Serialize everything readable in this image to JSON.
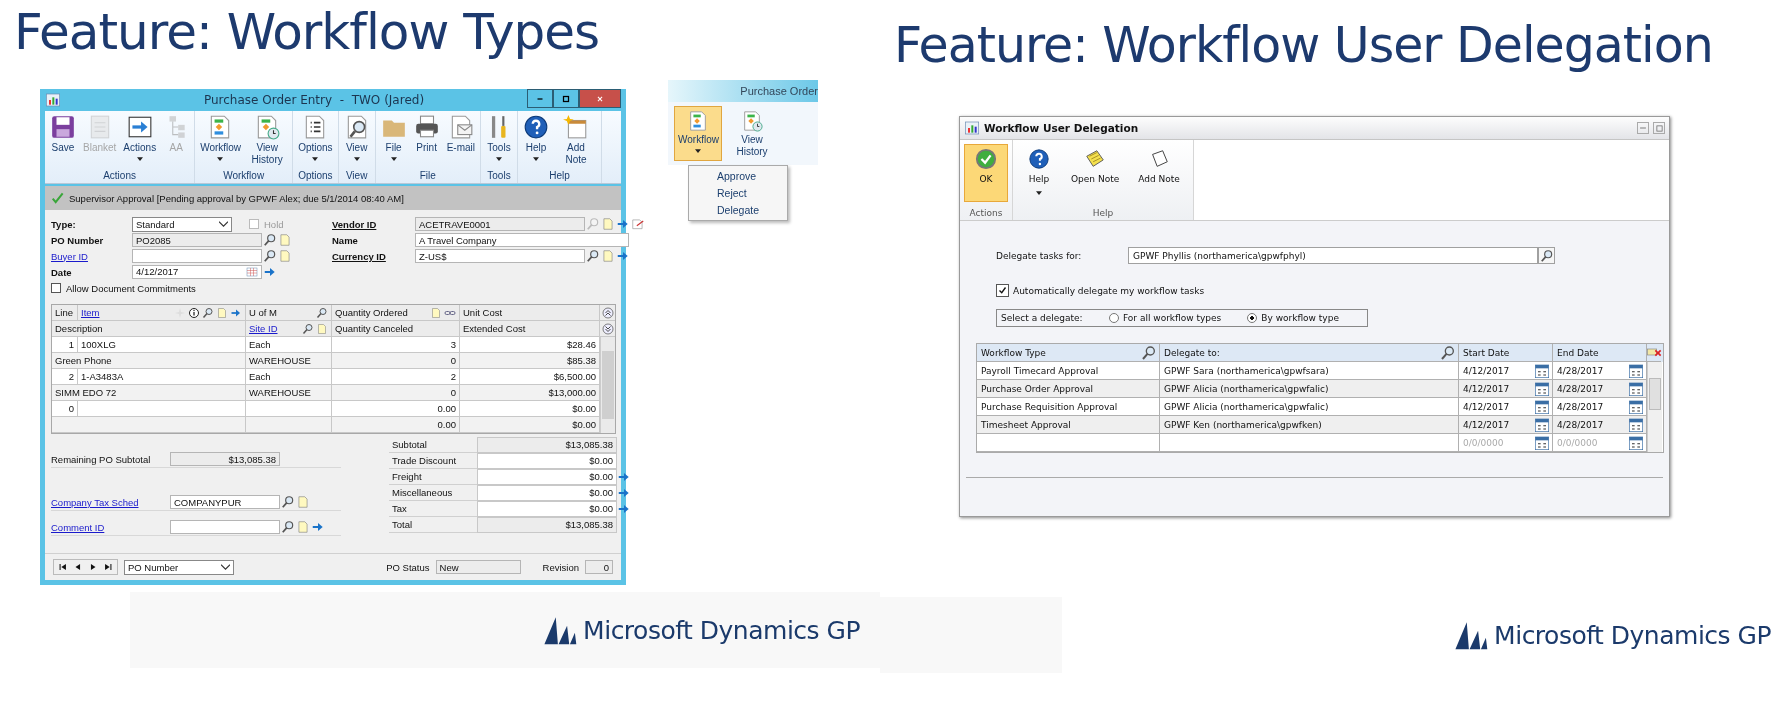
{
  "left_slide": {
    "title": "Feature: Workflow Types",
    "window": {
      "title": "Purchase Order Entry  -  TWO (Jared)",
      "ribbon": [
        {
          "label": "Actions",
          "buttons": [
            {
              "label": "Save",
              "disabled": false,
              "dropdown": false
            },
            {
              "label": "Blanket",
              "disabled": true,
              "dropdown": false
            },
            {
              "label": "Actions",
              "disabled": false,
              "dropdown": true
            },
            {
              "label": "AA",
              "disabled": true,
              "dropdown": false
            }
          ]
        },
        {
          "label": "Workflow",
          "buttons": [
            {
              "label": "Workflow",
              "disabled": false,
              "dropdown": true
            },
            {
              "label": "View History",
              "disabled": false,
              "dropdown": false
            }
          ]
        },
        {
          "label": "Options",
          "buttons": [
            {
              "label": "Options",
              "disabled": false,
              "dropdown": true
            }
          ]
        },
        {
          "label": "View",
          "buttons": [
            {
              "label": "View",
              "disabled": false,
              "dropdown": true
            }
          ]
        },
        {
          "label": "File",
          "buttons": [
            {
              "label": "File",
              "disabled": false,
              "dropdown": true
            },
            {
              "label": "Print",
              "disabled": false,
              "dropdown": false
            },
            {
              "label": "E-mail",
              "disabled": false,
              "dropdown": false
            }
          ]
        },
        {
          "label": "Tools",
          "buttons": [
            {
              "label": "Tools",
              "disabled": false,
              "dropdown": true
            }
          ]
        },
        {
          "label": "Help",
          "buttons": [
            {
              "label": "Help",
              "disabled": false,
              "dropdown": true
            },
            {
              "label": "Add Note",
              "disabled": false,
              "dropdown": false
            }
          ]
        }
      ],
      "approval": "Supervisor Approval [Pending approval by GPWF Alex; due 5/1/2014 08:40 AM]",
      "type": {
        "label": "Type:",
        "value": "Standard"
      },
      "hold": {
        "label": "Hold",
        "checked": false,
        "disabled": true
      },
      "po_number": {
        "label": "PO Number",
        "value": "PO2085"
      },
      "buyer_id": {
        "label": "Buyer ID"
      },
      "date": {
        "label": "Date",
        "value": "4/12/2017"
      },
      "allow_commitments": {
        "label": "Allow Document Commitments",
        "checked": false
      },
      "vendor_id": {
        "label": "Vendor ID",
        "value": "ACETRAVE0001"
      },
      "name": {
        "label": "Name",
        "value": "A Travel Company"
      },
      "currency_id": {
        "label": "Currency ID",
        "value": "Z-US$"
      },
      "grid": {
        "header_1": [
          "Line",
          "Item",
          "U of M",
          "Quantity Ordered",
          "Unit Cost"
        ],
        "header_2": [
          "Description",
          "Site ID",
          "Quantity Canceled",
          "Extended Cost"
        ],
        "rows": [
          {
            "kind": "line",
            "line": "1",
            "item": "100XLG",
            "uom": "Each",
            "quantity": "3",
            "cost": "$28.46"
          },
          {
            "kind": "description",
            "description": "Green Phone",
            "site": "WAREHOUSE",
            "quantity": "0",
            "cost": "$85.38"
          },
          {
            "kind": "line",
            "line": "2",
            "item": "1-A3483A",
            "uom": "Each",
            "quantity": "2",
            "cost": "$6,500.00"
          },
          {
            "kind": "description",
            "description": "SIMM EDO 72",
            "site": "WAREHOUSE",
            "quantity": "0",
            "cost": "$13,000.00"
          },
          {
            "kind": "line",
            "line": "0",
            "quantity": "0.00",
            "cost": "$0.00"
          },
          {
            "kind": "description",
            "quantity": "0.00",
            "cost": "$0.00"
          }
        ]
      },
      "remaining": {
        "label": "Remaining PO Subtotal",
        "value": "$13,085.38"
      },
      "tax_sched": {
        "label": "Company Tax Sched",
        "value": "COMPANYPUR"
      },
      "comment_id": {
        "label": "Comment ID"
      },
      "totals": [
        {
          "label": "Subtotal",
          "value": "$13,085.38",
          "expand": false
        },
        {
          "label": "Trade Discount",
          "value": "$0.00",
          "expand": false
        },
        {
          "label": "Freight",
          "value": "$0.00",
          "expand": true
        },
        {
          "label": "Miscellaneous",
          "value": "$0.00",
          "expand": true
        },
        {
          "label": "Tax",
          "value": "$0.00",
          "expand": true
        },
        {
          "label": "Total",
          "value": "$13,085.38",
          "expand": false
        }
      ],
      "browse_by": "PO Number",
      "po_status": {
        "label": "PO Status",
        "value": "New"
      },
      "revision": {
        "label": "Revision",
        "value": "0"
      }
    },
    "popup": {
      "title": "Purchase Order",
      "buttons": [
        {
          "label": "Workflow",
          "selected": true,
          "dropdown": true
        },
        {
          "label": "View History",
          "selected": false,
          "dropdown": false
        }
      ],
      "menu": [
        "Approve",
        "Reject",
        "Delegate"
      ]
    },
    "logo": "Microsoft Dynamics GP"
  },
  "right_slide": {
    "title": "Feature: Workflow User Delegation",
    "window": {
      "title": "Workflow User Delegation",
      "ribbon": [
        {
          "label": "Actions",
          "buttons": [
            {
              "label": "OK",
              "selected": true,
              "dropdown": false
            }
          ]
        },
        {
          "label": "Help",
          "buttons": [
            {
              "label": "Help",
              "selected": false,
              "dropdown": true
            },
            {
              "label": "Open Note",
              "selected": false,
              "dropdown": false
            },
            {
              "label": "Add Note",
              "selected": false,
              "dropdown": false
            }
          ]
        }
      ],
      "delegate_for": {
        "label": "Delegate tasks for:",
        "value": "GPWF Phyllis (northamerica\\gpwfphyl)"
      },
      "auto_delegate": {
        "label": "Automatically delegate my workflow tasks",
        "checked": true
      },
      "select_delegate": {
        "label": "Select a delegate:",
        "options": [
          {
            "label": "For all workflow types",
            "selected": false
          },
          {
            "label": "By workflow type",
            "selected": true
          }
        ]
      },
      "table": {
        "columns": [
          "Workflow Type",
          "Delegate to:",
          "Start Date",
          "End Date"
        ],
        "rows": [
          {
            "workflow_type": "Payroll Timecard Approval",
            "delegate": "GPWF Sara (northamerica\\gpwfsara)",
            "start": "4/12/2017",
            "end": "4/28/2017"
          },
          {
            "workflow_type": "Purchase Order Approval",
            "delegate": "GPWF Alicia (northamerica\\gpwfalic)",
            "start": "4/12/2017",
            "end": "4/28/2017"
          },
          {
            "workflow_type": "Purchase Requisition Approval",
            "delegate": "GPWF Alicia (northamerica\\gpwfalic)",
            "start": "4/12/2017",
            "end": "4/28/2017"
          },
          {
            "workflow_type": "Timesheet Approval",
            "delegate": "GPWF Ken (northamerica\\gpwfken)",
            "start": "4/12/2017",
            "end": "4/28/2017"
          },
          {
            "start_placeholder": "0/0/0000",
            "end_placeholder": "0/0/0000"
          }
        ]
      }
    },
    "logo": "Microsoft Dynamics GP"
  }
}
